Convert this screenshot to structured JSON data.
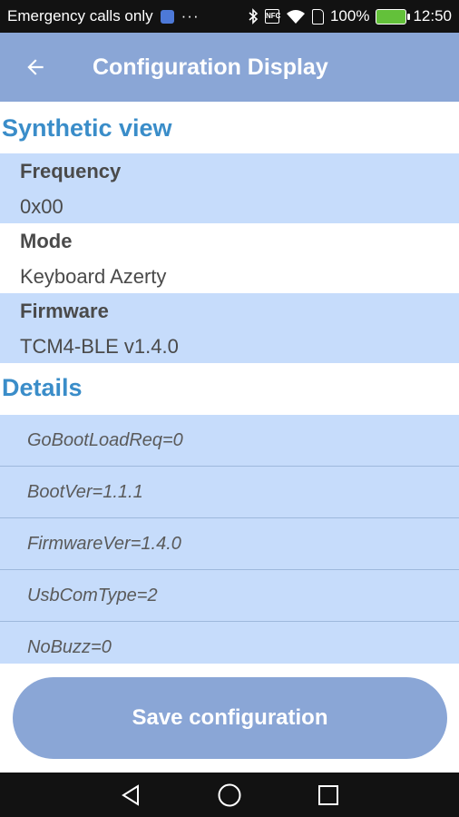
{
  "status_bar": {
    "carrier": "Emergency calls only",
    "overflow": "···",
    "nfc": "NFC",
    "battery": "100%",
    "time": "12:50",
    "icons": [
      "shield-icon",
      "bluetooth-icon",
      "nfc-icon",
      "wifi-icon",
      "sim-icon",
      "battery-charging-icon"
    ]
  },
  "app_bar": {
    "title": "Configuration Display",
    "back_icon": "arrow-back-icon"
  },
  "synthetic": {
    "title": "Synthetic view",
    "items": [
      {
        "label": "Frequency",
        "value": "0x00"
      },
      {
        "label": "Mode",
        "value": "Keyboard Azerty"
      },
      {
        "label": "Firmware",
        "value": "TCM4-BLE v1.4.0"
      }
    ]
  },
  "details": {
    "title": "Details",
    "items": [
      "GoBootLoadReq=0",
      "BootVer=1.1.1",
      "FirmwareVer=1.4.0",
      "UsbComType=2",
      "NoBuzz=0"
    ]
  },
  "save_button": {
    "label": "Save configuration"
  },
  "nav_bar": {
    "icons": [
      "back-triangle-icon",
      "home-circle-icon",
      "recents-square-icon"
    ]
  },
  "colors": {
    "accent": "#8aa6d6",
    "section_title": "#3a8dc9",
    "row_shade": "#c6dcfb",
    "system_bar": "#121212"
  }
}
